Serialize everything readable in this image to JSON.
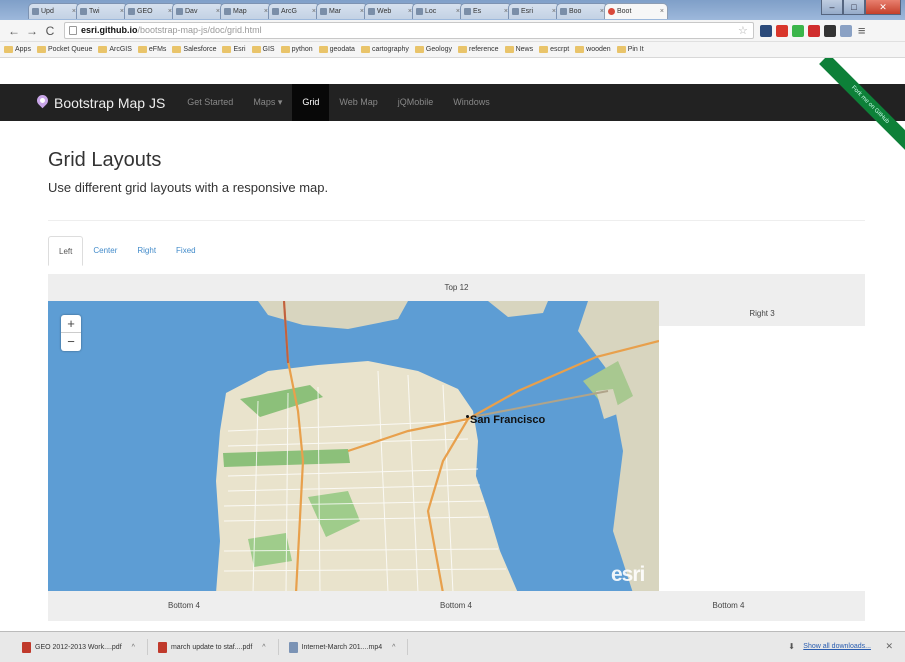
{
  "browser": {
    "tabs": [
      {
        "label": "Upd"
      },
      {
        "label": "Twi"
      },
      {
        "label": "GEO"
      },
      {
        "label": "Dav"
      },
      {
        "label": "Map"
      },
      {
        "label": "ArcG"
      },
      {
        "label": "Mar"
      },
      {
        "label": "Web"
      },
      {
        "label": "Loc"
      },
      {
        "label": "Es"
      },
      {
        "label": "Esri"
      },
      {
        "label": "Boo"
      },
      {
        "label": "Boot",
        "active": true
      }
    ],
    "url_host": "esri.github.io",
    "url_path": "/bootstrap-map-js/doc/grid.html",
    "bookmarks": [
      "Apps",
      "Pocket Queue",
      "ArcGIS",
      "eFMs",
      "Salesforce",
      "Esri",
      "GIS",
      "python",
      "geodata",
      "cartography",
      "Geology",
      "reference",
      "News",
      "escrpt",
      "wooden",
      "Pin It"
    ]
  },
  "navbar": {
    "brand": "Bootstrap Map JS",
    "links": [
      "Get Started",
      "Maps ▾",
      "Grid",
      "Web Map",
      "jQMobile",
      "Windows"
    ],
    "active_index": 2
  },
  "ribbon": "Fork me on GitHub",
  "page": {
    "title": "Grid Layouts",
    "subtitle": "Use different grid layouts with a responsive map."
  },
  "layout_tabs": [
    "Left",
    "Center",
    "Right",
    "Fixed"
  ],
  "grid": {
    "top": "Top 12",
    "right": "Right 3",
    "bottom": [
      "Bottom 4",
      "Bottom 4",
      "Bottom 4"
    ]
  },
  "map": {
    "city_label": "San Francisco",
    "attribution": "esri",
    "zoom_in": "+",
    "zoom_out": "−"
  },
  "downloads": {
    "items": [
      "GEO 2012-2013 Work....pdf",
      "march update to staf....pdf",
      "Internet-March 201....mp4"
    ],
    "show_all": "Show all downloads..."
  },
  "colors": {
    "navbar": "#222222",
    "water": "#5d9dd4",
    "land": "#e8e0c8",
    "park": "#8cc07a",
    "ribbon": "#0d8038",
    "link": "#428bca"
  }
}
